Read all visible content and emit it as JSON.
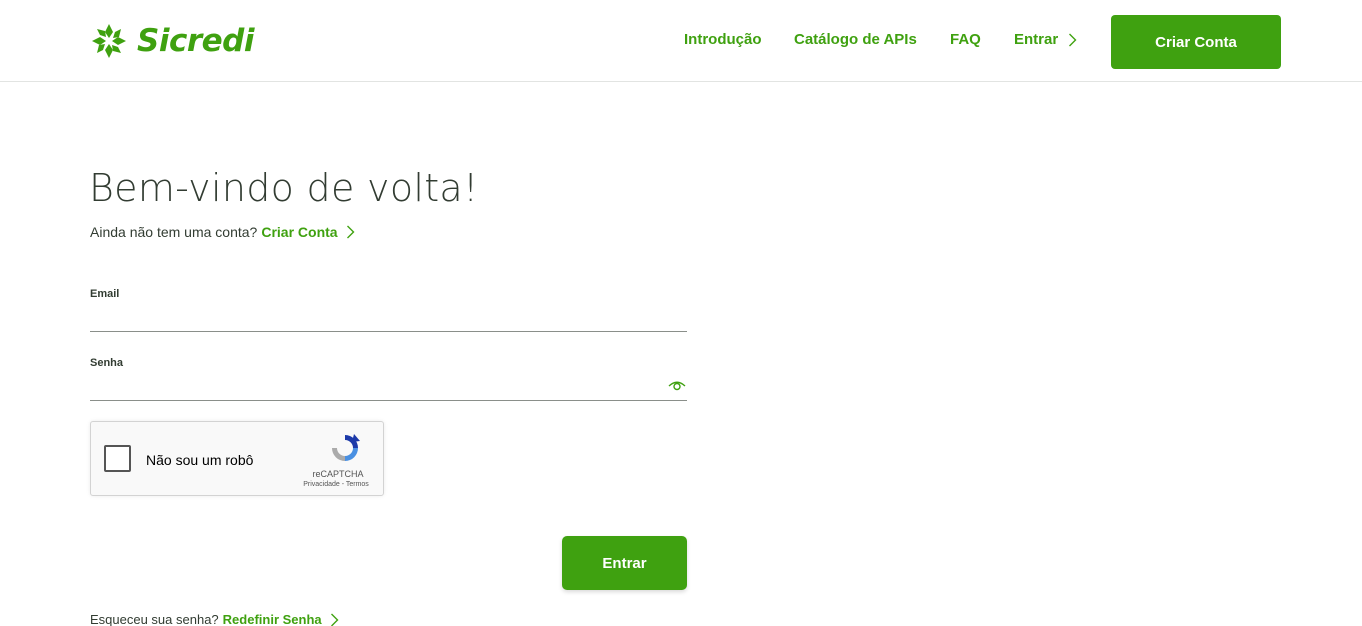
{
  "header": {
    "logo_text": "Sicredi",
    "nav": {
      "intro": "Introdução",
      "catalog": "Catálogo de APIs",
      "faq": "FAQ",
      "entrar": "Entrar"
    },
    "create_account": "Criar Conta"
  },
  "main": {
    "title": "Bem-vindo de volta!",
    "no_account_text": "Ainda não tem uma conta?",
    "create_link": "Criar Conta",
    "email_label": "Email",
    "email_value": "",
    "password_label": "Senha",
    "password_value": "",
    "submit_label": "Entrar",
    "forgot_text": "Esqueceu sua senha?",
    "reset_link": "Redefinir Senha"
  },
  "captcha": {
    "label": "Não sou um robô",
    "brand": "reCAPTCHA",
    "links": "Privacidade - Termos",
    "checked": false
  },
  "colors": {
    "brand_green": "#3fa110",
    "text": "#323c32"
  }
}
